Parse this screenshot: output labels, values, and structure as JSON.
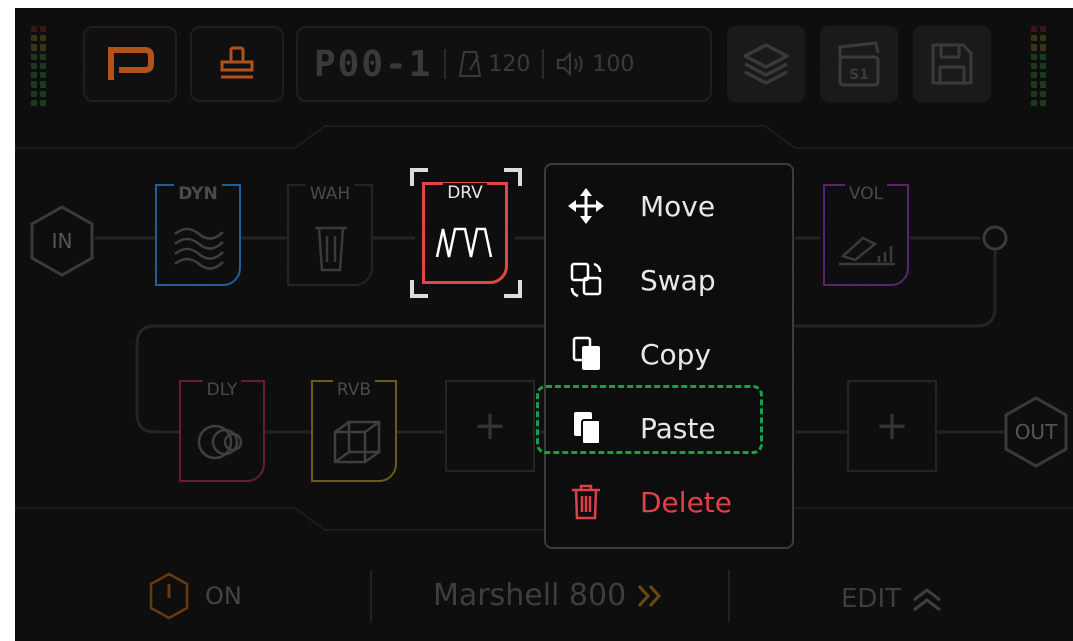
{
  "header": {
    "preset_letter_icon": "preset-p-icon",
    "patch_name": "P00-1",
    "tempo": "120",
    "volume": "100",
    "layers_icon": "layers-icon",
    "scene_label": "S1",
    "save_icon": "floppy-disk-icon"
  },
  "chain": {
    "input_label": "IN",
    "output_label": "OUT",
    "row1": [
      {
        "label": "DYN",
        "color": "#1f6fb2"
      },
      {
        "label": "WAH",
        "color": "#2a2a2a"
      },
      {
        "label": "DRV",
        "color": "#e04848",
        "selected": true
      },
      {
        "label": "VOL",
        "color": "#6a2a86"
      }
    ],
    "row2": [
      {
        "label": "DLY",
        "color": "#8a2040"
      },
      {
        "label": "RVB",
        "color": "#8a7a1a"
      },
      {
        "label": "+",
        "color": "#2a2a2a"
      },
      {
        "label": "+",
        "color": "#2a2a2a"
      }
    ]
  },
  "context_menu": {
    "items": [
      {
        "label": "Move",
        "icon": "move-arrows-icon",
        "color": "#e8e8e8"
      },
      {
        "label": "Swap",
        "icon": "swap-icon",
        "color": "#e8e8e8"
      },
      {
        "label": "Copy",
        "icon": "copy-icon",
        "color": "#e8e8e8"
      },
      {
        "label": "Paste",
        "icon": "paste-icon",
        "color": "#e8e8e8",
        "highlighted": true
      },
      {
        "label": "Delete",
        "icon": "trash-icon",
        "color": "#e0404a"
      }
    ]
  },
  "footer": {
    "power_label": "ON",
    "amp_name": "Marshell 800",
    "edit_label": "EDIT"
  },
  "colors": {
    "accent_orange": "#c95a1a",
    "highlight_green": "#1b9e4b",
    "delete_red": "#e0404a"
  }
}
